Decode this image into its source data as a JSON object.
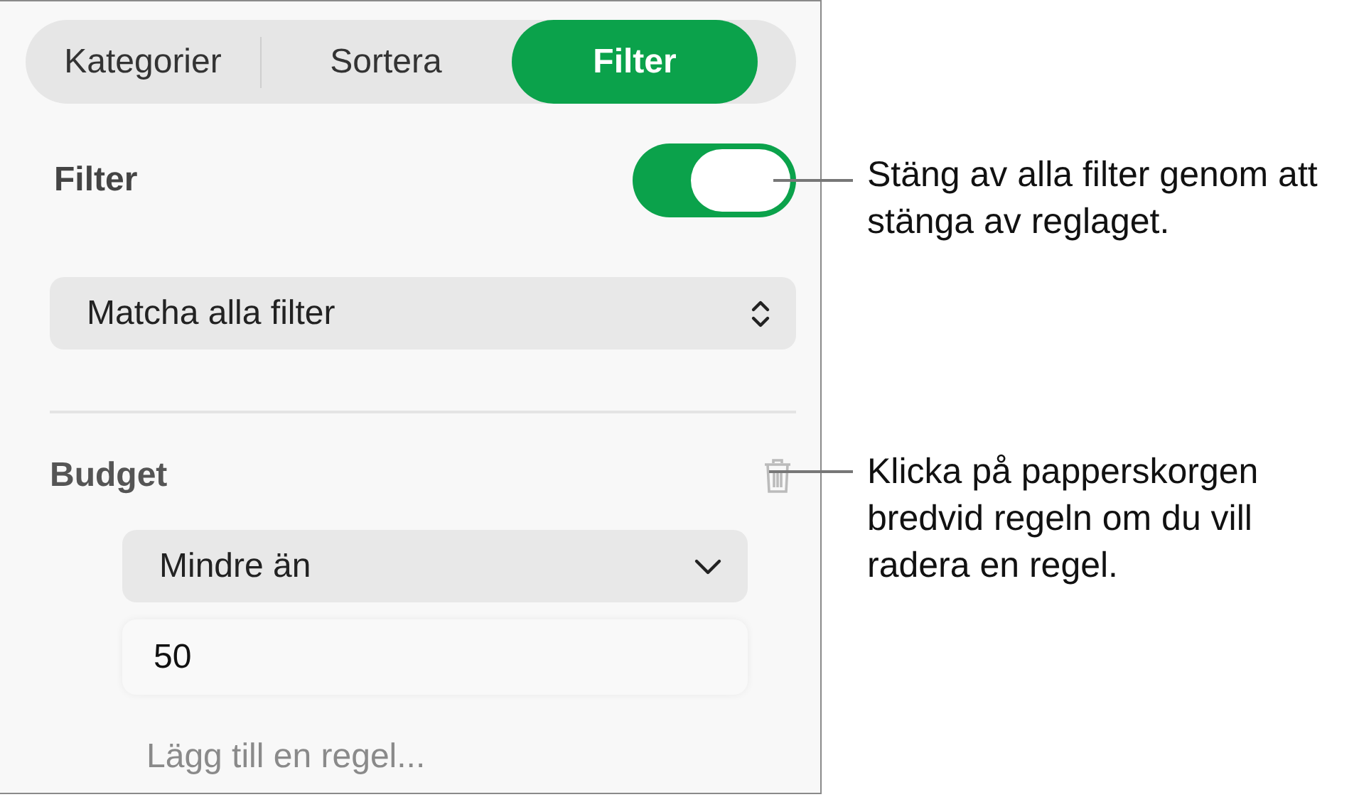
{
  "tabs": [
    {
      "label": "Kategorier",
      "selected": false
    },
    {
      "label": "Sortera",
      "selected": false
    },
    {
      "label": "Filter",
      "selected": true
    }
  ],
  "filter": {
    "label": "Filter",
    "on": true
  },
  "match_select": {
    "value": "Matcha alla filter"
  },
  "rules": [
    {
      "name": "Budget",
      "condition": "Mindre än",
      "value": "50"
    }
  ],
  "add_rule": "Lägg till en regel...",
  "callouts": [
    {
      "text": "Stäng av alla filter genom att stänga av reglaget."
    },
    {
      "text": "Klicka på papperskorgen bredvid regeln om du vill radera en regel."
    }
  ]
}
